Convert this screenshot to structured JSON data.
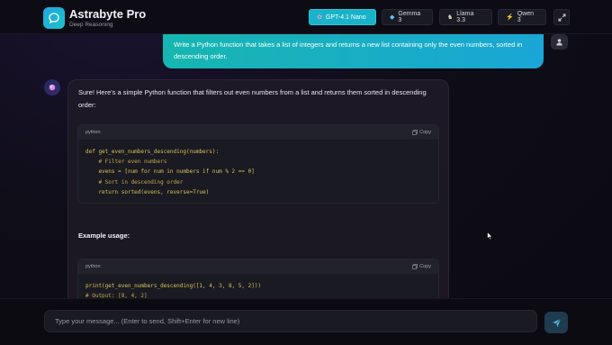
{
  "app": {
    "title": "Astrabyte Pro",
    "subtitle": "Deep Reasoning"
  },
  "models": [
    {
      "label": "GPT-4.1 Nano",
      "icon": "sparkle-icon",
      "active": true
    },
    {
      "label": "Gemma 3",
      "icon": "gem-icon",
      "active": false
    },
    {
      "label": "Llama 3.3",
      "icon": "llama-icon",
      "active": false
    },
    {
      "label": "Qwen 3",
      "icon": "bolt-icon",
      "active": false
    }
  ],
  "user_message": "Write a Python function that takes a list of integers and returns a new list containing only the even numbers, sorted in descending order.",
  "assistant": {
    "intro": "Sure! Here's a simple Python function that filters out even numbers from a list and returns them sorted in descending order:",
    "code1": {
      "lang": "python",
      "copy_label": "Copy",
      "lines": [
        "def get_even_numbers_descending(numbers):",
        "    # Filter even numbers",
        "    evens = [num for num in numbers if num % 2 == 0]",
        "    # Sort in descending order",
        "    return sorted(evens, reverse=True)"
      ]
    },
    "usage_label": "Example usage:",
    "code2": {
      "lang": "python",
      "copy_label": "Copy",
      "lines": [
        "print(get_even_numbers_descending([1, 4, 3, 8, 5, 2]))",
        "# Output: [8, 4, 2]"
      ]
    }
  },
  "input": {
    "placeholder": "Type your message... (Enter to send, Shift+Enter for new line)"
  },
  "colors": {
    "accent": "#19b3c9",
    "user_bubble_start": "#16b6b0",
    "user_bubble_end": "#1aa6d6",
    "code_text": "#d8c45a"
  }
}
